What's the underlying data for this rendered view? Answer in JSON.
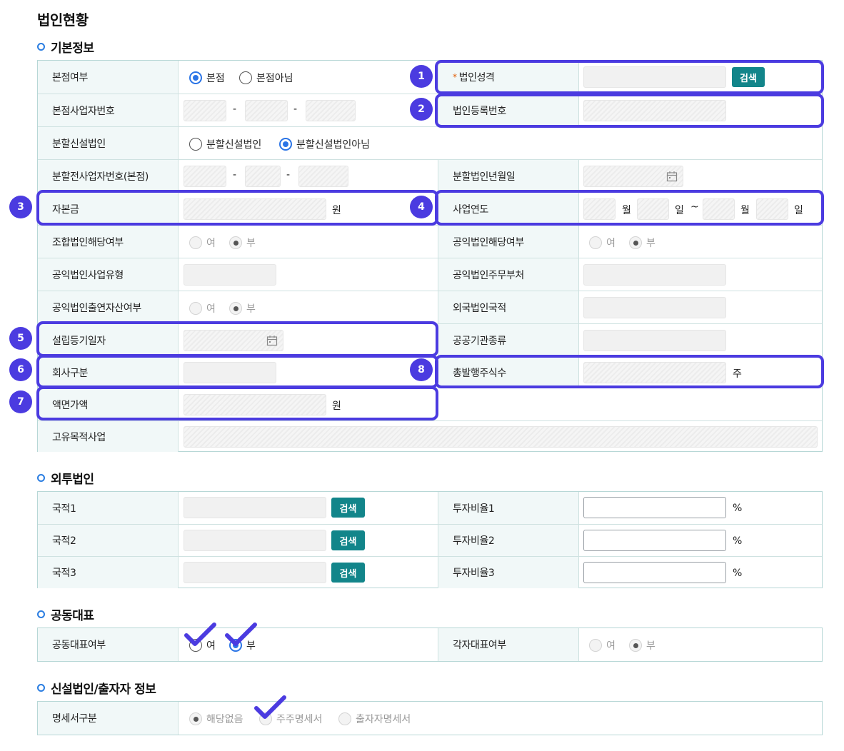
{
  "page_title": "법인현황",
  "sections": {
    "basic": "기본정보",
    "foreign": "외투법인",
    "co_rep": "공동대표",
    "new_corp": "신설법인/출자자 정보"
  },
  "basic": {
    "hq_label": "본점여부",
    "hq_opt1": "본점",
    "hq_opt2": "본점아님",
    "corp_type_label": "법인성격",
    "corp_type_req": "*",
    "search_btn": "검색",
    "hq_bizno_label": "본점사업자번호",
    "dash": "-",
    "corp_regno_label": "법인등록번호",
    "split_label": "분할신설법인",
    "split_opt1": "분할신설법인",
    "split_opt2": "분할신설법인아님",
    "pre_split_label": "분할전사업자번호(본점)",
    "split_date_label": "분할법인년월일",
    "capital_label": "자본금",
    "won": "원",
    "fiscal_label": "사업연도",
    "month": "월",
    "day": "일",
    "tilde": "~",
    "coop_label": "조합법인해당여부",
    "yes": "여",
    "no": "부",
    "public_label": "공익법인해당여부",
    "public_type_label": "공익법인사업유형",
    "public_dept_label": "공익법인주무부처",
    "public_asset_label": "공익법인출연자산여부",
    "foreign_nat_label": "외국법인국적",
    "est_date_label": "설립등기일자",
    "public_org_label": "공공기관종류",
    "company_type_label": "회사구분",
    "total_shares_label": "총발행주식수",
    "shares_unit": "주",
    "par_value_label": "액면가액",
    "purpose_label": "고유목적사업"
  },
  "foreign": {
    "rows": [
      {
        "nat_label": "국적1",
        "ratio_label": "투자비율1"
      },
      {
        "nat_label": "국적2",
        "ratio_label": "투자비율2"
      },
      {
        "nat_label": "국적3",
        "ratio_label": "투자비율3"
      }
    ],
    "search_btn": "검색",
    "percent": "%"
  },
  "co_rep": {
    "label": "공동대표여부",
    "yes": "여",
    "no": "부",
    "each_label": "각자대표여부"
  },
  "new_corp": {
    "label": "명세서구분",
    "opt1": "해당없음",
    "opt2": "주주명세서",
    "opt3": "출자자명세서"
  },
  "badges": [
    "1",
    "2",
    "3",
    "4",
    "5",
    "6",
    "7",
    "8"
  ],
  "colors": {
    "highlight": "#4b3be0",
    "button": "#12858a",
    "radio_on": "#2a74e6",
    "label_bg": "#f1f8f8"
  },
  "icons": [
    "calendar-icon",
    "check-mark-icon"
  ]
}
